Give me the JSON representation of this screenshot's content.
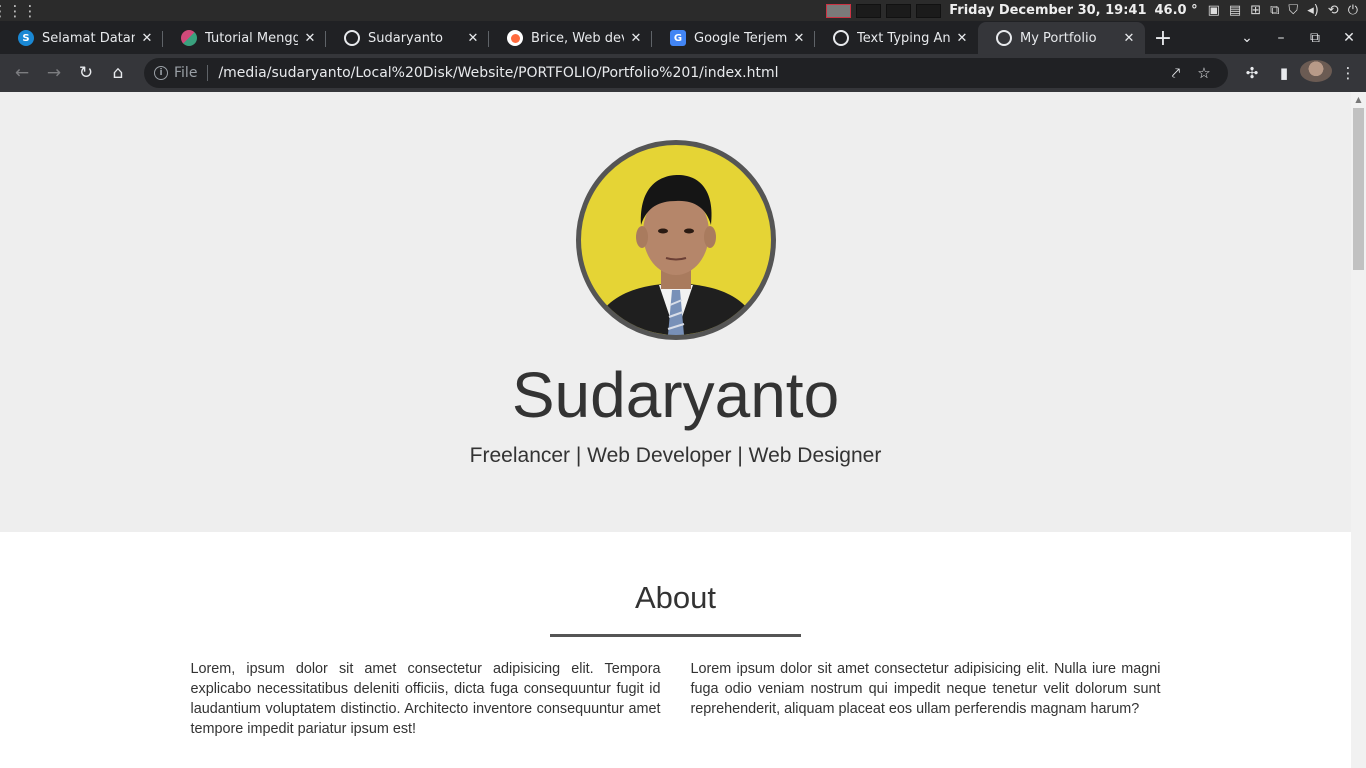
{
  "os": {
    "clock": "Friday December 30, 19:41",
    "temperature": "46.0 °"
  },
  "tabs": [
    {
      "title": "Selamat Datang",
      "favicon": "skype-s-icon",
      "color": "#1a88d4"
    },
    {
      "title": "Tutorial Menggu",
      "favicon": "app-icon",
      "color": "#d04a7a"
    },
    {
      "title": "Sudaryanto",
      "favicon": "globe-icon",
      "color": "#e8eaed"
    },
    {
      "title": "Brice, Web devel",
      "favicon": "brice-icon",
      "color": "#ff6a3d"
    },
    {
      "title": "Google Terjemah",
      "favicon": "translate-icon",
      "color": "#4285f4"
    },
    {
      "title": "Text Typing Anim",
      "favicon": "globe-icon",
      "color": "#e8eaed"
    },
    {
      "title": "My Portfolio",
      "favicon": "globe-icon",
      "color": "#e8eaed",
      "active": true
    }
  ],
  "omnibox": {
    "scheme": "File",
    "url": "/media/sudaryanto/Local%20Disk/Website/PORTFOLIO/Portfolio%201/index.html"
  },
  "page": {
    "hero": {
      "name": "Sudaryanto",
      "tagline": "Freelancer | Web Developer | Web Designer"
    },
    "about": {
      "heading": "About",
      "left_text": "Lorem, ipsum dolor sit amet consectetur adipisicing elit. Tempora explicabo necessitatibus deleniti officiis, dicta fuga consequuntur fugit id laudantium voluptatem distinctio. Architecto inventore consequuntur amet tempore impedit pariatur ipsum est!",
      "right_text": "Lorem ipsum dolor sit amet consectetur adipisicing elit. Nulla iure magni fuga odio veniam nostrum qui impedit neque tenetur velit dolorum sunt reprehenderit, aliquam placeat eos ullam perferendis magnam harum?"
    }
  },
  "colors": {
    "hero_background": "#eeeeee",
    "photo_background": "#e5d435",
    "text": "#333333"
  }
}
